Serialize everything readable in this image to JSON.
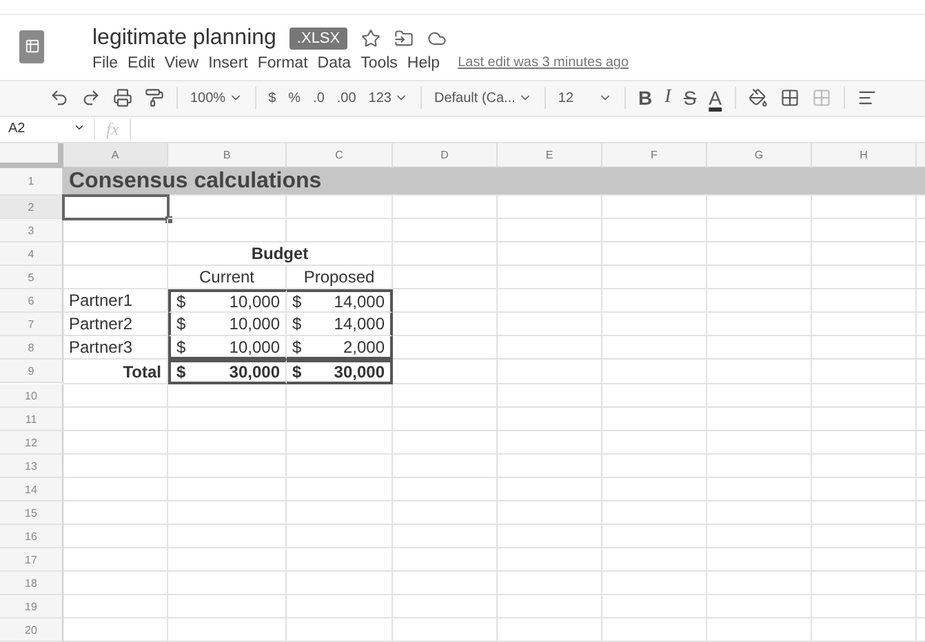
{
  "document": {
    "title": "legitimate planning",
    "badge": ".XLSX"
  },
  "menu": [
    "File",
    "Edit",
    "View",
    "Insert",
    "Format",
    "Data",
    "Tools",
    "Help"
  ],
  "last_edit": "Last edit was 3 minutes ago",
  "toolbar": {
    "zoom": "100%",
    "currency": "$",
    "percent": "%",
    "decrease_decimals": ".0",
    "increase_decimals": ".00",
    "number_format": "123",
    "font": "Default (Ca...",
    "font_size": "12",
    "bold": "B",
    "italic": "I",
    "strikethrough": "S",
    "text_color": "A"
  },
  "formula_bar": {
    "cell": "A2",
    "fx": "fx"
  },
  "columns": [
    {
      "label": "A",
      "selected": true
    },
    {
      "label": "B",
      "selected": false
    },
    {
      "label": "C",
      "selected": false
    },
    {
      "label": "D",
      "selected": false
    },
    {
      "label": "E",
      "selected": false
    },
    {
      "label": "F",
      "selected": false
    },
    {
      "label": "G",
      "selected": false
    },
    {
      "label": "H",
      "selected": false
    }
  ],
  "rows": [
    {
      "number": "1",
      "kind": "title",
      "selected": false,
      "text": "Consensus calculations"
    },
    {
      "number": "2",
      "kind": "blank",
      "selected": true
    },
    {
      "number": "3",
      "kind": "blank",
      "selected": false
    },
    {
      "number": "4",
      "kind": "header",
      "selected": false,
      "text": "Budget"
    },
    {
      "number": "5",
      "kind": "subheader",
      "selected": false,
      "b": "Current",
      "c": "Proposed"
    },
    {
      "number": "6",
      "kind": "data",
      "selected": false,
      "label": "Partner1",
      "b_symbol": "$",
      "b": "10,000",
      "c_symbol": "$",
      "c": "14,000"
    },
    {
      "number": "7",
      "kind": "data",
      "selected": false,
      "label": "Partner2",
      "b_symbol": "$",
      "b": "10,000",
      "c_symbol": "$",
      "c": "14,000"
    },
    {
      "number": "8",
      "kind": "data",
      "selected": false,
      "label": "Partner3",
      "b_symbol": "$",
      "b": "10,000",
      "c_symbol": "$",
      "c": "2,000"
    },
    {
      "number": "9",
      "kind": "total",
      "selected": false,
      "label": "Total",
      "b_symbol": "$",
      "b": "30,000",
      "c_symbol": "$",
      "c": "30,000"
    },
    {
      "number": "10",
      "kind": "blank",
      "selected": false
    },
    {
      "number": "11",
      "kind": "blank",
      "selected": false
    },
    {
      "number": "12",
      "kind": "blank",
      "selected": false
    },
    {
      "number": "13",
      "kind": "blank",
      "selected": false
    },
    {
      "number": "14",
      "kind": "blank",
      "selected": false
    },
    {
      "number": "15",
      "kind": "blank",
      "selected": false
    },
    {
      "number": "16",
      "kind": "blank",
      "selected": false
    },
    {
      "number": "17",
      "kind": "blank",
      "selected": false
    },
    {
      "number": "18",
      "kind": "blank",
      "selected": false
    },
    {
      "number": "19",
      "kind": "blank",
      "selected": false
    },
    {
      "number": "20",
      "kind": "blank",
      "selected": false
    }
  ]
}
